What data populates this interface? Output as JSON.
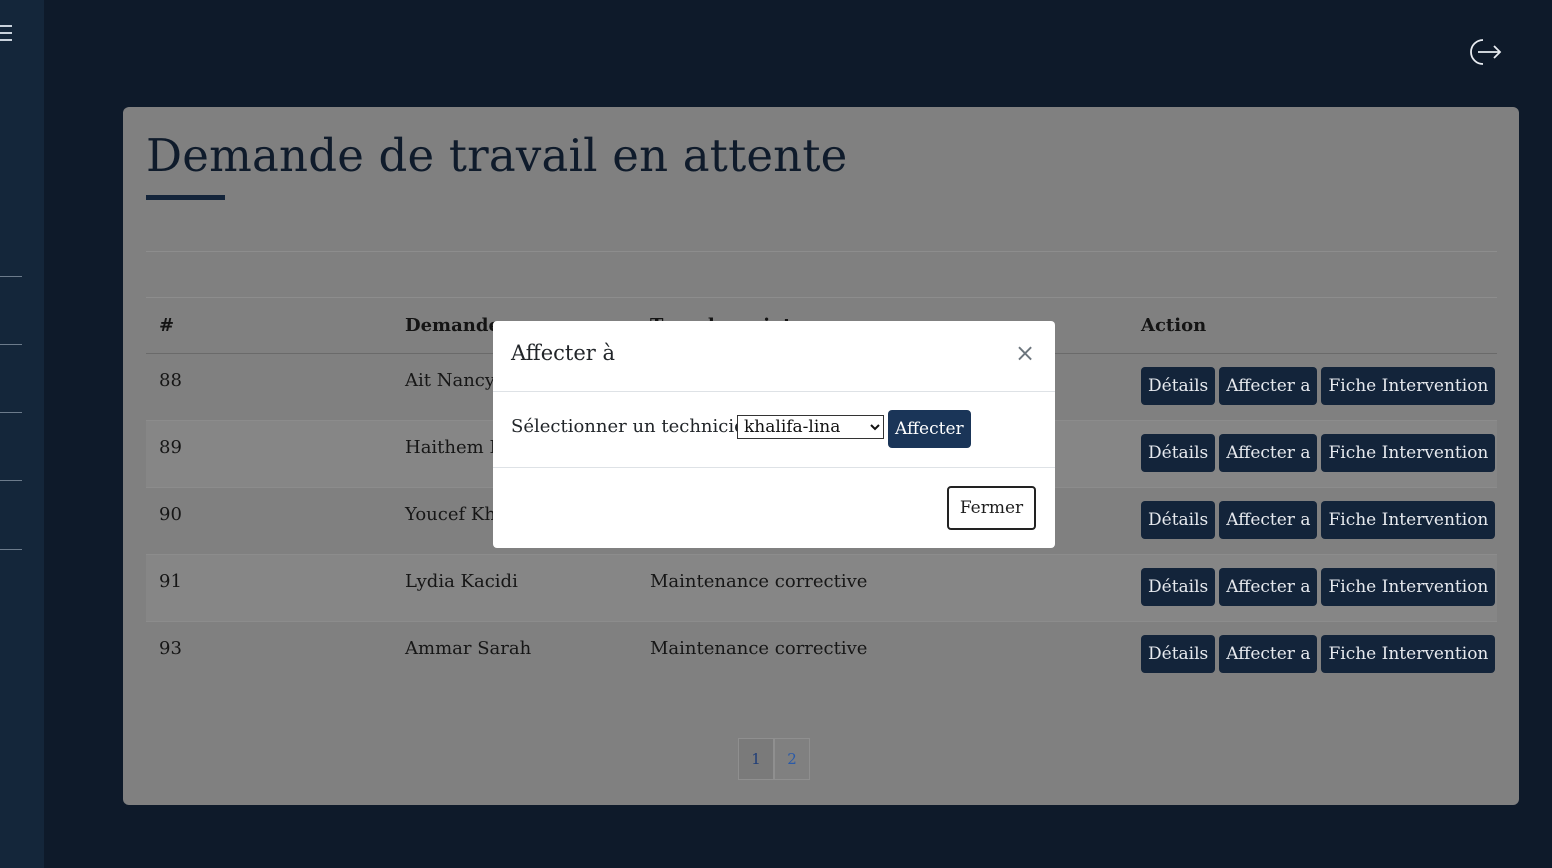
{
  "page": {
    "title": "Demande de travail en attente"
  },
  "table": {
    "headers": [
      "#",
      "Demande",
      "Type de maintenance",
      "Action"
    ],
    "rows": [
      {
        "id": "88",
        "demandeur": "Ait Nancy",
        "type": ""
      },
      {
        "id": "89",
        "demandeur": "Haithem L",
        "type": ""
      },
      {
        "id": "90",
        "demandeur": "Youcef Khr",
        "type": ""
      },
      {
        "id": "91",
        "demandeur": "Lydia Kacidi",
        "type": "Maintenance corrective"
      },
      {
        "id": "93",
        "demandeur": "Ammar Sarah",
        "type": "Maintenance corrective"
      }
    ],
    "actions": {
      "details": "Détails",
      "assign": "Affecter a",
      "intervention": "Fiche Intervention"
    }
  },
  "pagination": {
    "pages": [
      "1",
      "2"
    ],
    "active": "1"
  },
  "modal": {
    "title": "Affecter à",
    "close_symbol": "×",
    "select_label": "Sélectionner un technicien :",
    "selected_technician": "khalifa-lina",
    "assign_label": "Affecter",
    "close_label": "Fermer"
  },
  "icons": {
    "menu": "hamburger-icon",
    "logout": "logout-icon"
  },
  "colors": {
    "background": "#0e1a2a",
    "button": "#13243a",
    "card": "#808080"
  }
}
